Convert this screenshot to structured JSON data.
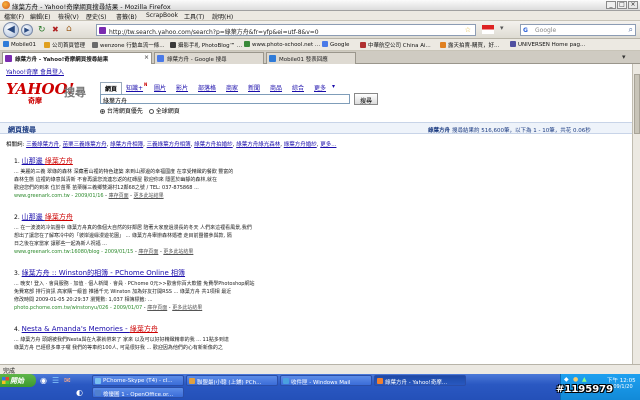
{
  "window": {
    "title": "綠葉方舟 - Yahoo!奇摩網頁搜尋結果 - Mozilla Firefox",
    "min": "_",
    "max": "□",
    "close": "×"
  },
  "menu": [
    "檔案(F)",
    "編輯(E)",
    "檢視(V)",
    "歷史(S)",
    "書籤(B)",
    "ScrapBook",
    "工具(T)",
    "說明(H)"
  ],
  "nav": {
    "url": "http://tw.search.yahoo.com/search?p=綠葉方舟&fr=yfp&ei=utf-8&v=0",
    "search_placeholder": "Google"
  },
  "bookmarks": [
    {
      "label": "Mobile01",
      "color": "#2f7bd8"
    },
    {
      "label": "公司首頁管理",
      "color": "#e0a020"
    },
    {
      "label": "wenzone 行動血流一條...",
      "color": "#6a6a6a"
    },
    {
      "label": "攝影手札 PhotoBlog™ ...",
      "color": "#3a3a3a"
    },
    {
      "label": "www.photo-school.net ...",
      "color": "#3a8a3a"
    },
    {
      "label": "Google",
      "color": "#4a7ae8"
    },
    {
      "label": "中華航空公司 China Ai...",
      "color": "#b03030"
    },
    {
      "label": "露天拍賣-購買，好...",
      "color": "#e08020"
    },
    {
      "label": "UNIVERSEN Home pag...",
      "color": "#5050a0"
    }
  ],
  "tabs": [
    {
      "label": "綠葉方舟 - Yahoo!奇摩網頁搜尋結果",
      "color": "#7a2bb0"
    },
    {
      "label": "綠葉方舟 - Google 搜尋",
      "color": "#4a7ae8"
    },
    {
      "label": "Mobile01 發表回應",
      "color": "#2f7bd8"
    }
  ],
  "yahoo": {
    "top_links": "Yahoo!奇摩  會員登入",
    "logo": "YAHOO!",
    "logo_sub": "奇摩",
    "logo_search": "搜尋",
    "search_tabs": [
      "網頁",
      "知識+",
      "圖片",
      "影片",
      "部落格",
      "商家",
      "新聞",
      "商品",
      "綜合",
      "更多"
    ],
    "query": "綠葉方舟",
    "search_button": "搜尋",
    "radio1": "台灣網頁優先",
    "radio2": "全球網頁",
    "section_title": "網頁搜尋",
    "result_info_query": "綠葉方舟",
    "result_info": "搜尋結果約 516,600筆，以下為 1 - 10筆，共花 0.06秒",
    "related_label": "相關詞:",
    "related": [
      "三義綠葉方舟",
      "苗栗三義綠葉方舟",
      "綠葉方舟相簿",
      "三義綠葉方舟相簿",
      "綠葉方舟拍婚紗",
      "綠葉方舟綠光森林",
      "綠葉方舟婚紗",
      "更多..."
    ]
  },
  "results": [
    {
      "title_prefix": "山那邊 ",
      "title_hl": "綠葉方舟",
      "snippet1": "... 美麗的三義 翠綠的森林 深藏著山裡的特色建築 來到山那邊的幸福國度 在享受精緻的餐飲 豐富的",
      "snippet2": "森林生態 這裡的綠意與清新 不會再讓您流連忘返的紅磚屋 歡迎你來 隱匿於幽靜的森林,就在",
      "snippet3": "歡迎您們的到來 位於苗栗 苗栗縣三義鄉雙湖村12鄰68之號 / TEL: 037-875868 ...",
      "url": "www.greenark.com.tw - 2009/01/16",
      "cache": "庫存頁面",
      "more": "更多此站結果"
    },
    {
      "title_prefix": "山那邊 ",
      "title_hl": "綠葉方舟",
      "snippet1": "... 在一波波的冷氣團中 綠葉方舟真的像個大自然的好鄰居 陪著大家度過漫長的冬天 人們來這裡看風景,我們",
      "snippet2": "想出了讓您在了解寒冷中的「彼岸邊緣漫遊花園」 ... 綠葉方舟舉辦森林婚禮 走目前團體參與款, 隔",
      "snippet3": "日之後在家當家 讓那些一起為新人祝福 ...",
      "url": "www.greenark.com.tw:16080/blog - 2009/01/15",
      "cache": "庫存頁面",
      "more": "更多此站結果"
    },
    {
      "title_prefix": "綠葉方舟 :: Winston的相簿 - PChome Online 相簿",
      "title_hl": "",
      "snippet1": "... 晚安! 登入 · 會員服務 · 加值 · 個人新聞 · 會員 · PChome 0元>>歡會你百大軟體 免費學Photoshop網站",
      "snippet2": "免費寫部 排行資訊 高家購一級首 推播千元 Winston 加為好友打開RSS ... 綠葉方舟 共1項相 最近",
      "snippet3": "修改時間 2009-01-05 20:29:37 瀏覽數: 1,037 相簿標籤: ...",
      "url": "photo.pchome.com.tw/winstonyu/026 - 2009/01/07",
      "cache": "庫存頁面",
      "more": "更多此站結果"
    },
    {
      "title_prefix": "Nesta & Amanda's Memories - ",
      "title_hl": "綠葉方舟",
      "snippet1": "... 綠葉方舟 頭期被我們Nesta與在九寨就帶來了 家來 以及可以好好精緻精菲的我 ... 11點多到達",
      "snippet2": "綠葉方舟 已經很多車子囉 我們的等車約100人, 可是很好我 ... 歡迎因為他們的心有新新像的之",
      "snippet3": "",
      "url": "",
      "cache": "",
      "more": ""
    }
  ],
  "status": "完成",
  "taskbar": {
    "start": "開始",
    "tasks": [
      {
        "label": "PChome-Skype (T4) - cl...",
        "color": "#7ac0f0"
      },
      {
        "label": "聯盟最(小聰 (上鋪) PCh...",
        "color": "#e0a040"
      },
      {
        "label": "收件匣 - Windows Mail",
        "color": "#4aa0e0"
      },
      {
        "label": "綠葉方舟 - Yahoo!奇摩...",
        "color": "#f08030"
      },
      {
        "label": "檢優圖 1 - OpenOffice.or...",
        "color": "#5080d0"
      }
    ],
    "clock": "下午 12:05",
    "date": "2009/1/20"
  },
  "watermark": "#1195979"
}
